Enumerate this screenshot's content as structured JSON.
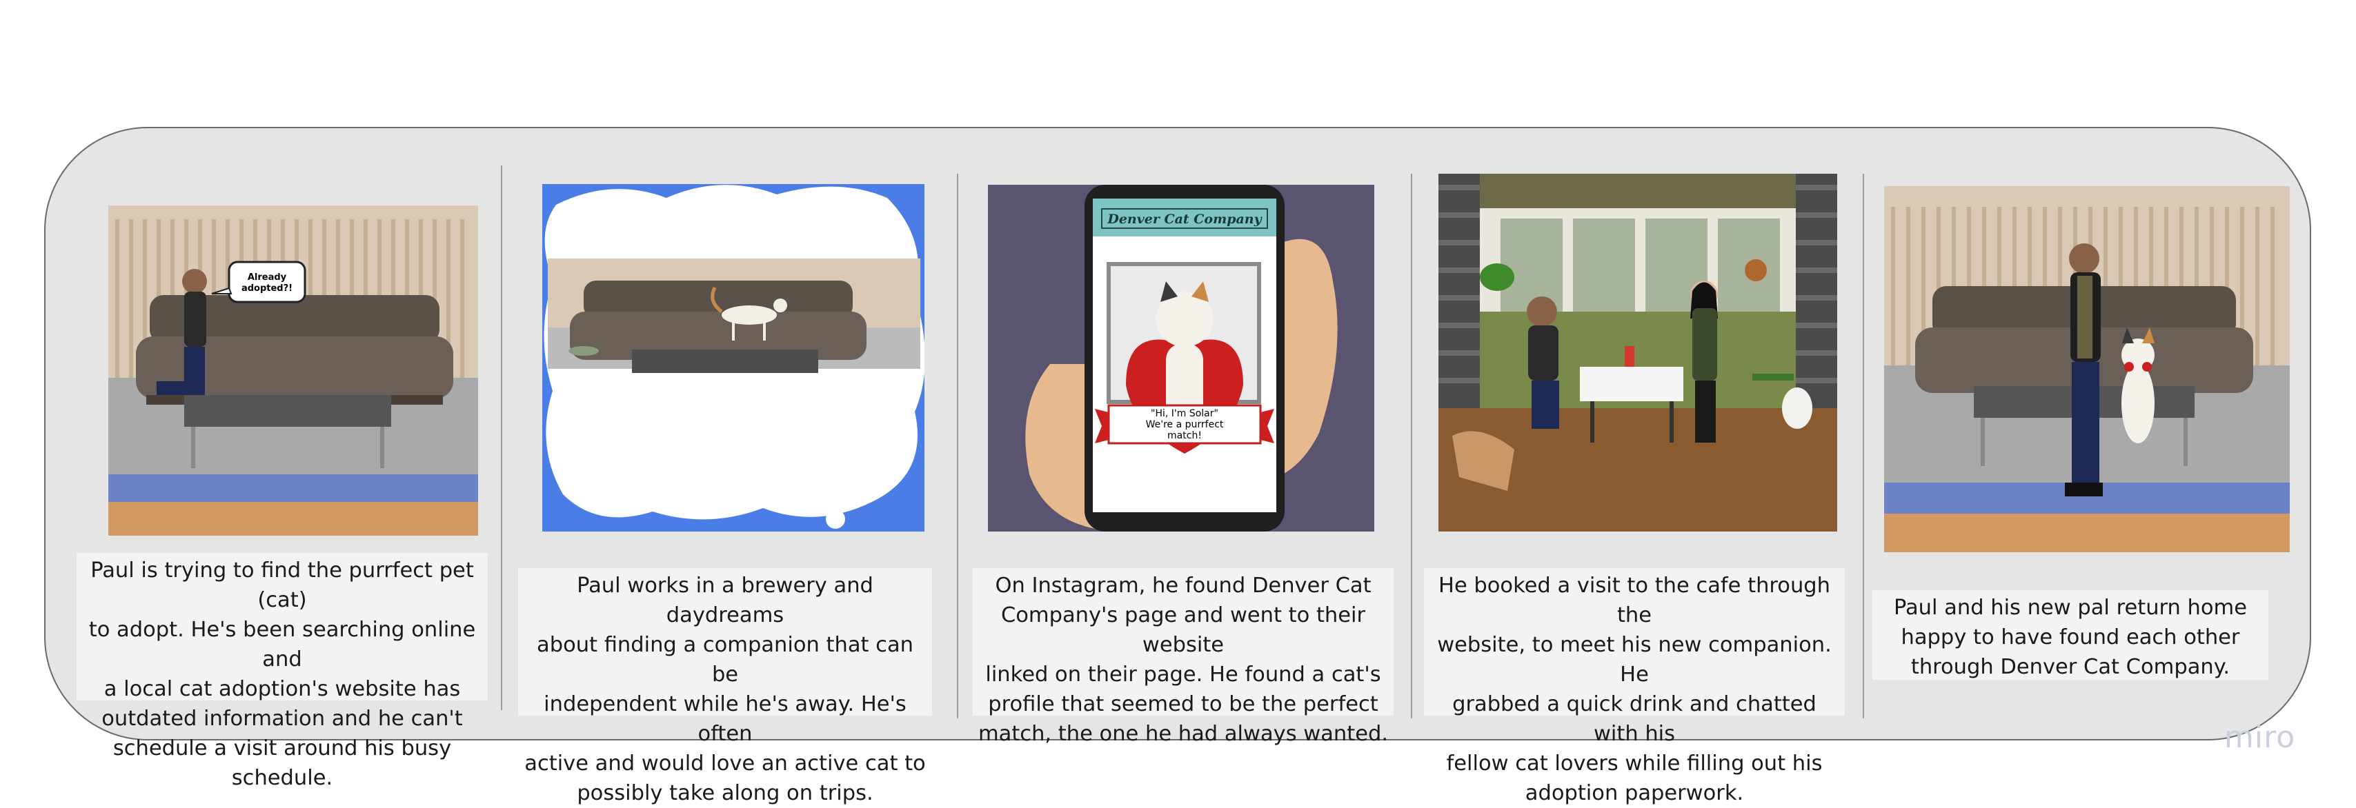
{
  "storyboard": {
    "panels": [
      {
        "caption": "Paul is trying to find the purrfect pet (cat)\nto adopt. He's been searching online and\na local cat adoption's website has\noutdated information and he can't\nschedule a visit around his busy schedule.",
        "speech": "Already\nadopted?!"
      },
      {
        "caption": "Paul works in a brewery and daydreams\nabout finding a companion that can be\nindependent while he's away. He's often\nactive and would love an active cat to\npossibly take along on trips."
      },
      {
        "caption": "On Instagram, he found Denver Cat\nCompany's page and went to their website\nlinked on their page. He found a cat's\nprofile that seemed to be the perfect\nmatch, the one he had always wanted.",
        "phone_header": "Denver Cat Company",
        "banner_text": "\"Hi, I'm Solar\"\nWe're a purrfect\nmatch!"
      },
      {
        "caption": "He booked a visit to the cafe through the\nwebsite, to meet his new companion. He\ngrabbed a quick drink and chatted with his\nfellow cat lovers while filling out his\nadoption paperwork."
      },
      {
        "caption": "Paul and his new pal return home\nhappy to have found each other\nthrough Denver Cat Company."
      }
    ]
  },
  "watermark": "miro",
  "colors": {
    "board_bg": "#e5e5e5",
    "board_border": "#6b6b6b",
    "caption_bg": "#f3f3f3",
    "thought_blue": "#4a7ee6",
    "phone_bg": "#5a5470",
    "phone_header": "#7ec4c2",
    "heart_red": "#cc1f1f"
  }
}
